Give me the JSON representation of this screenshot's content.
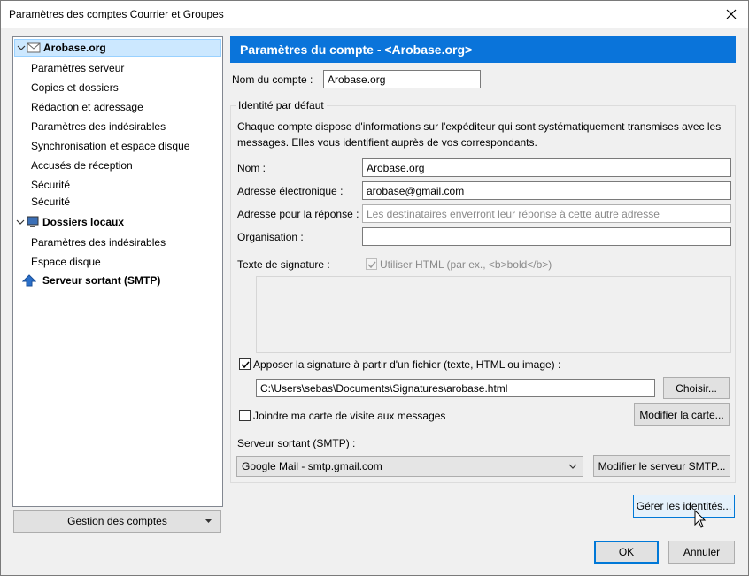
{
  "window": {
    "title": "Paramètres des comptes Courrier et Groupes"
  },
  "tree": {
    "account_name": "Arobase.org",
    "account_children": [
      "Paramètres serveur",
      "Copies et dossiers",
      "Rédaction et adressage",
      "Paramètres des indésirables",
      "Synchronisation et espace disque",
      "Accusés de réception",
      "Sécurité",
      "Sécurité"
    ],
    "local_folders": "Dossiers locaux",
    "local_children": [
      "Paramètres des indésirables",
      "Espace disque"
    ],
    "smtp": "Serveur sortant (SMTP)"
  },
  "manage_accounts_label": "Gestion des comptes",
  "header": {
    "title": "Paramètres du compte - <Arobase.org>"
  },
  "account_name_label": "Nom du compte :",
  "account_name_value": "Arobase.org",
  "identity": {
    "group_title": "Identité par défaut",
    "description": "Chaque compte dispose d'informations sur l'expéditeur qui sont systématiquement transmises avec les messages. Elles vous identifient auprès de vos correspondants.",
    "name_label": "Nom :",
    "name_value": "Arobase.org",
    "email_label": "Adresse électronique :",
    "email_value": "arobase@gmail.com",
    "reply_label": "Adresse pour la réponse :",
    "reply_placeholder": "Les destinataires enverront leur réponse à cette autre adresse",
    "org_label": "Organisation :",
    "org_value": "",
    "signature_label": "Texte de signature :",
    "html_checkbox_label": "Utiliser HTML (par ex., <b>bold</b>)",
    "attach_sig_label": "Apposer la signature à partir d'un fichier (texte, HTML ou image) :",
    "sig_path": "C:\\Users\\sebas\\Documents\\Signatures\\arobase.html",
    "choose_button": "Choisir...",
    "vcard_label": "Joindre ma carte de visite aux messages",
    "edit_card_button": "Modifier la carte...",
    "smtp_label": "Serveur sortant (SMTP) :",
    "smtp_value": "Google Mail - smtp.gmail.com",
    "edit_smtp_button": "Modifier le serveur SMTP..."
  },
  "manage_identities_button": "Gérer les identités...",
  "ok_button": "OK",
  "cancel_button": "Annuler",
  "colors": {
    "accent": "#0a74da",
    "selection": "#cce8ff"
  }
}
